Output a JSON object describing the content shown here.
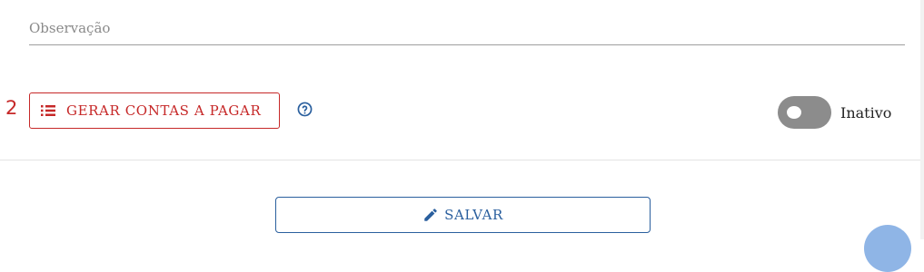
{
  "observacao": {
    "placeholder": "Observação",
    "value": ""
  },
  "step_number": "2",
  "gerar_button": {
    "label": "GERAR CONTAS A PAGAR",
    "icon": "list-icon"
  },
  "help": {
    "icon": "help-circle-icon"
  },
  "status_toggle": {
    "label": "Inativo",
    "checked": false
  },
  "salvar_button": {
    "label": "SALVAR",
    "icon": "pencil-icon"
  },
  "colors": {
    "danger": "#c62828",
    "primary": "#2a5f9e",
    "toggle_off": "#8c8c8c",
    "fab": "#8fb5e6"
  }
}
